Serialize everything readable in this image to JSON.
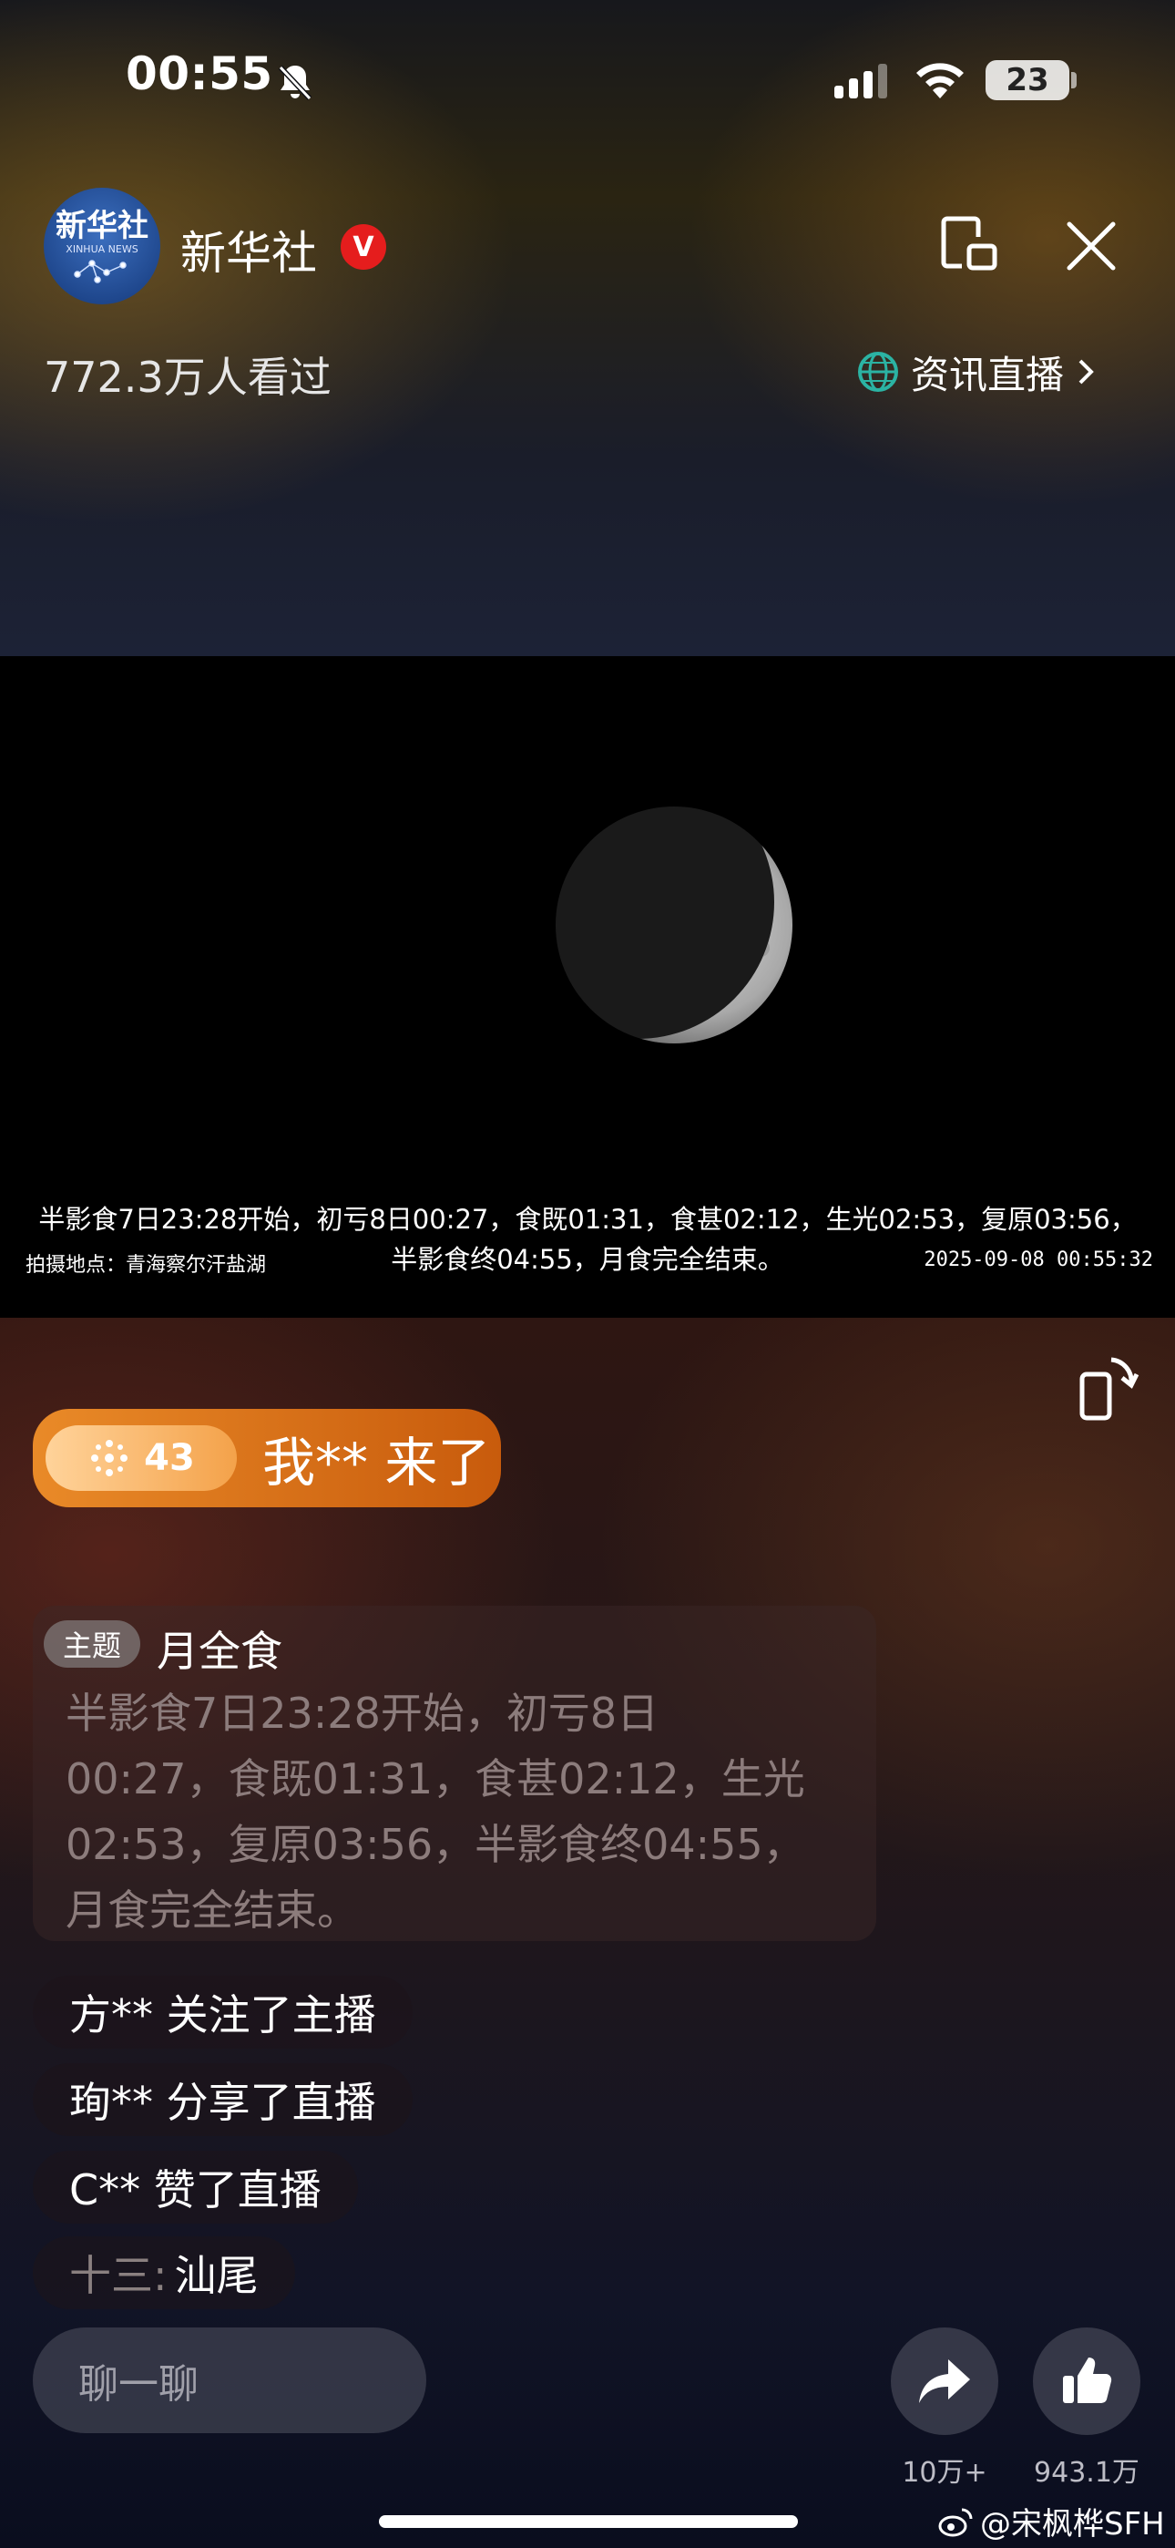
{
  "status_bar": {
    "time": "00:55",
    "battery": "23",
    "icons": [
      "bell-muted-icon",
      "cellular-signal-icon",
      "wifi-icon",
      "battery-icon"
    ]
  },
  "header": {
    "avatar_text": "新华社",
    "avatar_subtext": "XINHUA NEWS",
    "account_name": "新华社",
    "verified_badge": "V",
    "viewers": "772.3万人看过",
    "channel_label": "资讯直播",
    "icons": [
      "picture-in-picture-icon",
      "close-icon",
      "globe-icon",
      "chevron-right-icon"
    ]
  },
  "video": {
    "caption_line1": "半影食7日23:28开始，初亏8日00:27，食既01:31，食甚02:12，生光02:53，复原03:56，",
    "caption_line2": "半影食终04:55，月食完全结束。",
    "location": "拍摄地点：青海察尔汗盐湖",
    "timestamp": "2025-09-08 00:55:32"
  },
  "join_notice": {
    "level": "43",
    "text": "我** 来了"
  },
  "topic": {
    "tag": "主题",
    "title": "月全食",
    "description_lines": [
      "半影食7日23:28开始，初亏8日",
      "00:27，食既01:31，食甚02:12，生光",
      "02:53，复原03:56，半影食终04:55，",
      "月食完全结束。"
    ]
  },
  "messages": [
    {
      "user": "",
      "text": "方** 关注了主播"
    },
    {
      "user": "",
      "text": "珣** 分享了直播"
    },
    {
      "user": "",
      "text": "C** 赞了直播"
    },
    {
      "user": "十三:",
      "text": "汕尾"
    }
  ],
  "bottom_bar": {
    "input_placeholder": "聊一聊",
    "share_count": "10万+",
    "like_count": "943.1万"
  },
  "watermark": "@宋枫桦SFH",
  "colors": {
    "accent_orange": "#e98a28",
    "verified_red": "#e51d1d",
    "globe_teal": "#2bb3a3"
  }
}
